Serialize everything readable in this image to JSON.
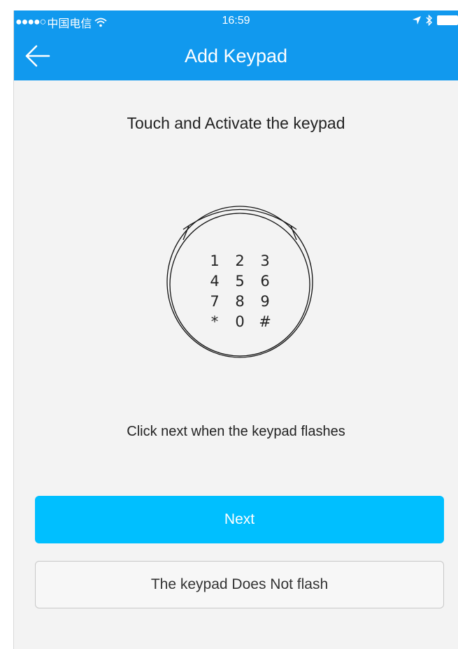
{
  "status_bar": {
    "signal_dots": "●●●●○",
    "carrier": "中国电信",
    "time": "16:59",
    "icons": [
      "wifi-icon",
      "location-arrow-icon",
      "bluetooth-icon",
      "battery-icon"
    ]
  },
  "nav": {
    "title": "Add Keypad",
    "back_icon": "arrow-left-icon"
  },
  "main": {
    "heading": "Touch and Activate the keypad",
    "keypad_keys": [
      "1",
      "2",
      "3",
      "4",
      "5",
      "6",
      "7",
      "8",
      "9",
      "*",
      "0",
      "#"
    ],
    "hint": "Click next when the keypad flashes"
  },
  "buttons": {
    "next_label": "Next",
    "no_flash_label": "The keypad Does Not flash"
  },
  "colors": {
    "header_blue": "#1199ee",
    "button_blue": "#00bfff",
    "background": "#f3f3f3"
  }
}
